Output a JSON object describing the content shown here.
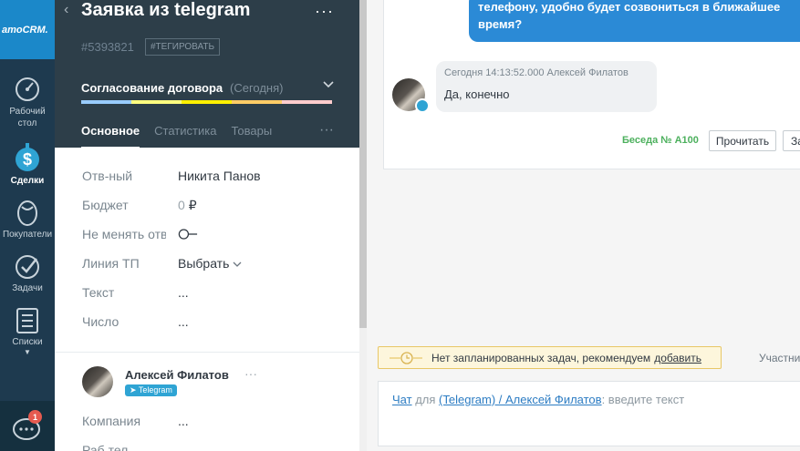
{
  "nav": {
    "logo": "amoCRM.",
    "items": [
      {
        "label": "Рабочий стол",
        "icon": "dashboard-icon"
      },
      {
        "label": "Сделки",
        "icon": "dollar-icon",
        "active": true
      },
      {
        "label": "Покупатели",
        "icon": "customers-icon"
      },
      {
        "label": "Задачи",
        "icon": "tasks-icon"
      },
      {
        "label": "Списки",
        "icon": "lists-icon"
      }
    ],
    "chat_badge": "1"
  },
  "card": {
    "back": "‹",
    "title": "Заявка из telegram",
    "menu": "···",
    "id": "#5393821",
    "tag_button": "#ТЕГИРОВАТЬ",
    "stage": "Согласование договора",
    "stage_date": "(Сегодня)",
    "stage_colors": [
      "#99ccfd",
      "#fffd7f",
      "#fff000",
      "#ffcc66",
      "#ffcccc"
    ],
    "tabs": [
      "Основное",
      "Статистика",
      "Товары"
    ],
    "tabs_menu": "···",
    "fields": [
      {
        "label": "Отв-ный",
        "value": "Никита Панов"
      },
      {
        "label": "Бюджет",
        "value": "0",
        "unit": "₽"
      },
      {
        "label": "Не менять ответственного",
        "value": ""
      },
      {
        "label": "Линия ТП",
        "value": "Выбрать"
      },
      {
        "label": "Текст",
        "value": "..."
      },
      {
        "label": "Число",
        "value": "..."
      }
    ],
    "contact": {
      "name": "Алексей Филатов",
      "menu": "···",
      "badge": "Telegram",
      "company_label": "Компания",
      "company_value": "...",
      "partial_label": "Раб.тел"
    }
  },
  "feed": {
    "outgoing_text": "телефону, удобно будет созвониться в ближайшее время?",
    "incoming_meta": "Сегодня 14:13:52.000 Алексей Филатов",
    "incoming_text": "Да, конечно",
    "thread_label": "Беседа № А100",
    "read_button": "Прочитать",
    "second_button": "За",
    "task_text": "Нет запланированных задач, рекомендуем",
    "task_link": "добавить",
    "participants": "Участни",
    "composer": {
      "chat": "Чат",
      "for": "для",
      "target": "(Telegram) / Алексей Филатов",
      "placeholder": ": введите текст"
    }
  }
}
